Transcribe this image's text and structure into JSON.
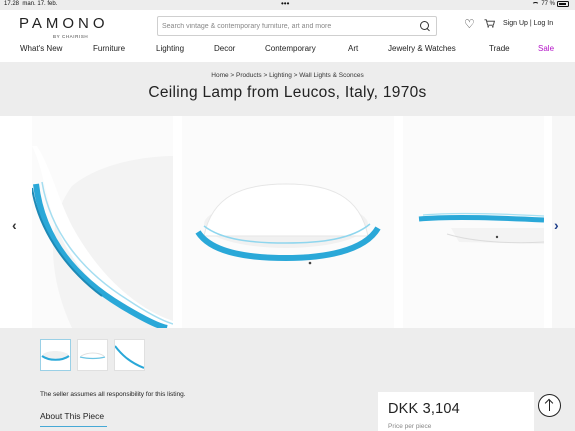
{
  "status_bar": {
    "time": "17.28",
    "date": "man. 17. feb.",
    "dots": "•••",
    "battery": "77 %"
  },
  "header": {
    "logo": "PAMONO",
    "logo_sub": "BY CHAIRISH",
    "search_placeholder": "Search vintage & contemporary furniture, art and more",
    "sign_up": "Sign Up",
    "separator": "|",
    "log_in": "Log In"
  },
  "nav": {
    "items": [
      {
        "label": "What's New"
      },
      {
        "label": "Furniture"
      },
      {
        "label": "Lighting"
      },
      {
        "label": "Decor"
      },
      {
        "label": "Contemporary"
      },
      {
        "label": "Art"
      },
      {
        "label": "Jewelry & Watches"
      },
      {
        "label": "Trade"
      },
      {
        "label": "Sale"
      }
    ]
  },
  "breadcrumb": "Home > Products > Lighting > Wall Lights & Sconces",
  "product": {
    "title": "Ceiling Lamp from Leucos, Italy, 1970s",
    "seller_note": "The seller assumes all responsibility for this listing.",
    "about_heading": "About This Piece",
    "price": "DKK 3,104",
    "price_sub": "Price per piece"
  },
  "colors": {
    "accent_blue": "#2aa8d8",
    "sale": "#b414c8",
    "nav_arrow": "#1f3f8a"
  },
  "icons": [
    "heart-icon",
    "cart-icon",
    "search-icon",
    "chevron-left-icon",
    "chevron-right-icon",
    "arrow-up-icon"
  ]
}
